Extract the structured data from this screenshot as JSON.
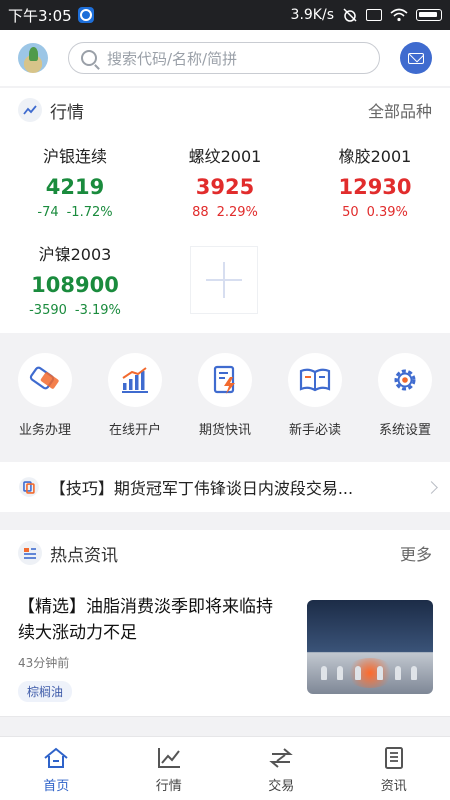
{
  "status_bar": {
    "time": "下午3:05",
    "net_speed": "3.9K/s"
  },
  "search": {
    "placeholder": "搜索代码/名称/简拼"
  },
  "quotes_section": {
    "title": "行情",
    "more": "全部品种",
    "items": [
      {
        "name": "沪银连续",
        "price": "4219",
        "change": "-74",
        "percent": "-1.72%",
        "trend": "down"
      },
      {
        "name": "螺纹2001",
        "price": "3925",
        "change": "88",
        "percent": "2.29%",
        "trend": "up"
      },
      {
        "name": "橡胶2001",
        "price": "12930",
        "change": "50",
        "percent": "0.39%",
        "trend": "up"
      },
      {
        "name": "沪镍2003",
        "price": "108900",
        "change": "-3590",
        "percent": "-3.19%",
        "trend": "down"
      }
    ]
  },
  "features": [
    {
      "label": "业务办理",
      "icon": "handshake-icon"
    },
    {
      "label": "在线开户",
      "icon": "bar-chart-icon"
    },
    {
      "label": "期货快讯",
      "icon": "flash-news-icon"
    },
    {
      "label": "新手必读",
      "icon": "open-book-icon"
    },
    {
      "label": "系统设置",
      "icon": "gear-icon"
    }
  ],
  "ticker": {
    "text": "【技巧】期货冠军丁伟锋谈日内波段交易..."
  },
  "hot_news": {
    "title": "热点资讯",
    "more": "更多",
    "article": {
      "title": "【精选】油脂消费淡季即将来临持续大涨动力不足",
      "time": "43分钟前",
      "tag": "棕榈油"
    }
  },
  "bottom_nav": [
    {
      "label": "首页",
      "icon": "home-icon",
      "active": true
    },
    {
      "label": "行情",
      "icon": "chart-icon",
      "active": false
    },
    {
      "label": "交易",
      "icon": "trade-icon",
      "active": false
    },
    {
      "label": "资讯",
      "icon": "news-icon",
      "active": false
    }
  ],
  "colors": {
    "accent": "#2f63c9",
    "down": "#1a8b3d",
    "up": "#e12c2c",
    "feature_icon": "#3f6bcf",
    "feature_highlight": "#f26a2e"
  }
}
